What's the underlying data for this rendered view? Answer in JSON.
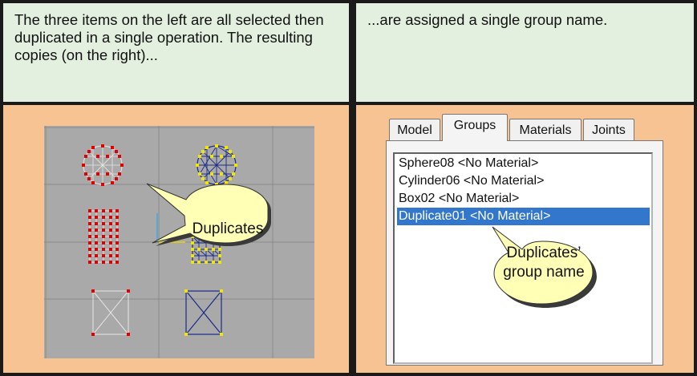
{
  "captions": {
    "left": "The three items on the left are all selected then duplicated in a single operation. The resulting copies (on the right)...",
    "right": "...are assigned a single group name."
  },
  "callouts": {
    "duplicates": "Duplicates",
    "group_name_line1": "Duplicates’",
    "group_name_line2": "group name"
  },
  "tabs": [
    {
      "label": "Model",
      "active": false
    },
    {
      "label": "Groups",
      "active": true
    },
    {
      "label": "Materials",
      "active": false
    },
    {
      "label": "Joints",
      "active": false
    }
  ],
  "groups_list": [
    {
      "label": "Sphere08 <No Material>",
      "selected": false
    },
    {
      "label": "Cylinder06 <No Material>",
      "selected": false
    },
    {
      "label": "Box02 <No Material>",
      "selected": false
    },
    {
      "label": "Duplicate01 <No Material>",
      "selected": true
    }
  ],
  "colors": {
    "caption_bg": "#e3efdf",
    "panel_bg": "#f8c393",
    "viewport_bg": "#a9a9a9",
    "callout_fill": "#ffffb5",
    "selection": "#3377cc",
    "original_vertex": "#e00000",
    "duplicate_vertex": "#f2e600",
    "duplicate_wire": "#1a2a8a"
  },
  "icons": [
    "sphere-wireframe",
    "cylinder-wireframe",
    "box-wireframe"
  ]
}
